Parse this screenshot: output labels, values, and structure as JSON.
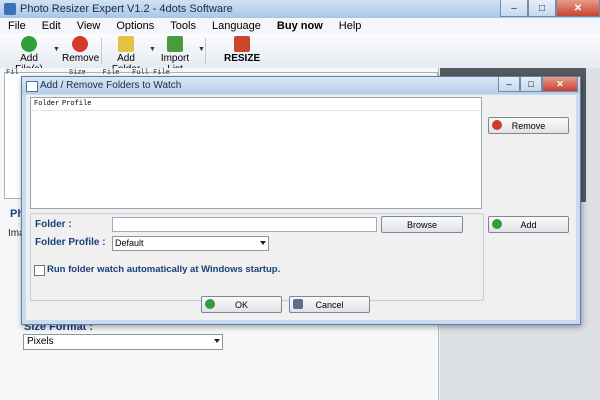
{
  "app": {
    "title": "Photo Resizer Expert V1.2 - 4dots Software",
    "window_buttons": {
      "minimize": "–",
      "maximize": "□",
      "close": "✕"
    }
  },
  "menu": [
    "File",
    "Edit",
    "View",
    "Options",
    "Tools",
    "Language",
    "Buy now",
    "Help"
  ],
  "toolbar": {
    "add_files": "Add File(s)",
    "remove": "Remove",
    "add_folder": "Add Folder",
    "import_list": "Import List",
    "resize": "RESIZE"
  },
  "file_list": {
    "columns": [
      "Fil",
      "Size",
      "File",
      "Full File"
    ]
  },
  "background": {
    "peek_heading": "Ph",
    "peek_item": "Ima",
    "size_format_label": "Size Format :",
    "size_format_value": "Pixels"
  },
  "dialog": {
    "title": "Add / Remove Folders to Watch",
    "window_buttons": {
      "minimize": "–",
      "maximize": "□",
      "close": "✕"
    },
    "list_columns": [
      "Folder",
      "Profile"
    ],
    "remove_button": "Remove",
    "folder_label": "Folder :",
    "folder_value": "",
    "browse_button": "Browse",
    "profile_label": "Folder Profile :",
    "profile_value": "Default",
    "add_button": "Add",
    "startup_checkbox_label": "Run folder watch automatically at Windows startup.",
    "startup_checked": false,
    "ok_button": "OK",
    "cancel_button": "Cancel"
  },
  "colors": {
    "label_blue": "#1a3f7a",
    "dialog_border": "#5d7fa6",
    "close_red": "#c8442e"
  }
}
